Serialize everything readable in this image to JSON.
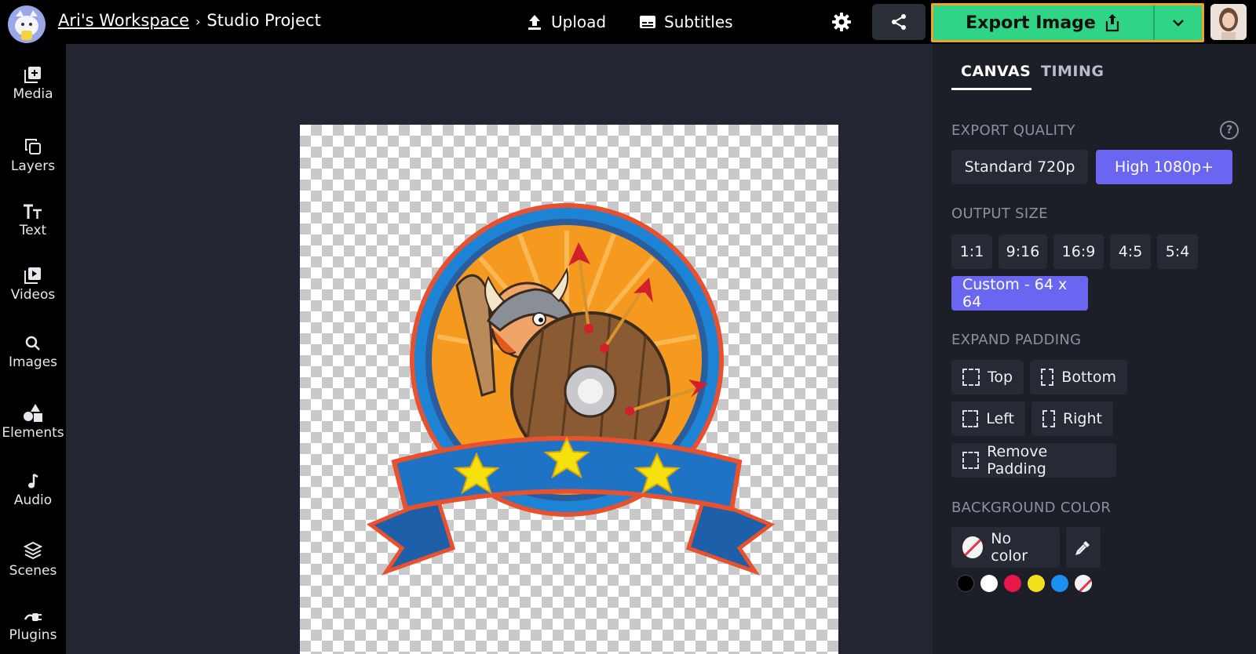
{
  "header": {
    "workspace": "Ari's Workspace",
    "separator": "›",
    "project": "Studio Project",
    "upload_label": "Upload",
    "subtitles_label": "Subtitles",
    "export_label": "Export Image"
  },
  "sidebar": {
    "items": [
      {
        "label": "Media",
        "icon": "media-add-icon"
      },
      {
        "label": "Layers",
        "icon": "layers-icon"
      },
      {
        "label": "Text",
        "icon": "text-icon"
      },
      {
        "label": "Videos",
        "icon": "video-icon"
      },
      {
        "label": "Images",
        "icon": "search-icon"
      },
      {
        "label": "Elements",
        "icon": "shapes-icon"
      },
      {
        "label": "Audio",
        "icon": "music-note-icon"
      },
      {
        "label": "Scenes",
        "icon": "stack-icon"
      },
      {
        "label": "Plugins",
        "icon": "plug-icon"
      }
    ]
  },
  "panel": {
    "tabs": [
      {
        "label": "CANVAS",
        "active": true
      },
      {
        "label": "TIMING",
        "active": false
      }
    ],
    "export_quality": {
      "heading": "EXPORT QUALITY",
      "help": "?",
      "options": [
        {
          "label": "Standard 720p",
          "selected": false
        },
        {
          "label": "High 1080p+",
          "selected": true
        }
      ]
    },
    "output_size": {
      "heading": "OUTPUT SIZE",
      "options": [
        "1:1",
        "9:16",
        "16:9",
        "4:5",
        "5:4"
      ],
      "custom": "Custom - 64 x 64"
    },
    "expand_padding": {
      "heading": "EXPAND PADDING",
      "top": "Top",
      "bottom": "Bottom",
      "left": "Left",
      "right": "Right",
      "remove": "Remove Padding"
    },
    "background_color": {
      "heading": "BACKGROUND COLOR",
      "no_color": "No color",
      "swatches": [
        "#000000",
        "#ffffff",
        "#e8194a",
        "#f3e01b",
        "#1d8ff0",
        "none"
      ]
    }
  },
  "colors": {
    "accent_export": "#2fd584",
    "export_border": "#f0a32b",
    "selected_chip": "#6b66f2"
  }
}
